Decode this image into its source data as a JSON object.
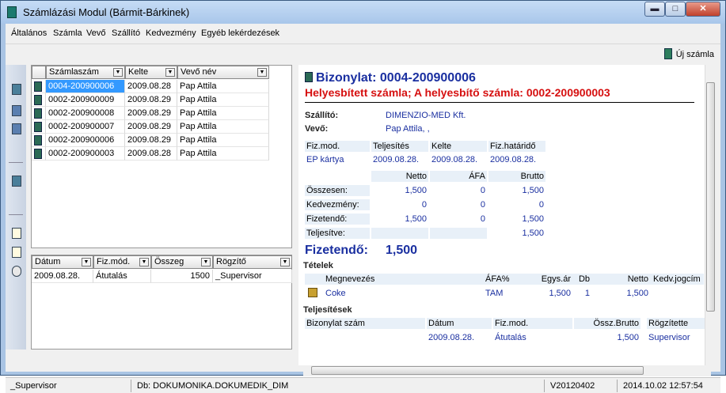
{
  "window": {
    "title": "Számlázási Modul (Bármit-Bárkinek)",
    "min": "▬",
    "max": "□",
    "close": "✕"
  },
  "menu": [
    "Általános",
    "Számla",
    "Vevő",
    "Szállító",
    "Kedvezmény",
    "Egyéb lekérdezések"
  ],
  "toolbar": {
    "new_invoice": "Új számla"
  },
  "invoices": {
    "columns": [
      "Számlaszám",
      "Kelte",
      "Vevő név"
    ],
    "rows": [
      {
        "num": "0004-200900006",
        "date": "2009.08.28",
        "name": "Pap Attila",
        "selected": true
      },
      {
        "num": "0002-200900009",
        "date": "2009.08.29",
        "name": "Pap Attila"
      },
      {
        "num": "0002-200900008",
        "date": "2009.08.29",
        "name": "Pap Attila"
      },
      {
        "num": "0002-200900007",
        "date": "2009.08.29",
        "name": "Pap Attila"
      },
      {
        "num": "0002-200900006",
        "date": "2009.08.29",
        "name": "Pap Attila"
      },
      {
        "num": "0002-200900003",
        "date": "2009.08.28",
        "name": "Pap Attila"
      }
    ]
  },
  "payments": {
    "columns": [
      "Dátum",
      "Fiz.mód.",
      "Összeg",
      "Rögzítő"
    ],
    "rows": [
      {
        "date": "2009.08.28.",
        "mode": "Átutalás",
        "amount": "1500",
        "by": "_Supervisor"
      }
    ]
  },
  "doc": {
    "title": "Bizonylat: 0004-200900006",
    "subtitle": "Helyesbített számla; A helyesbítő számla: 0002-200900003",
    "supplier_label": "Szállító:",
    "supplier": "DIMENZIO-MED Kft.",
    "customer_label": "Vevő:",
    "customer": "Pap Attila,  ,",
    "meta_headers": [
      "Fiz.mod.",
      "Teljesítés",
      "Kelte",
      "Fiz.határidő"
    ],
    "meta_values": [
      "EP kártya",
      "2009.08.28.",
      "2009.08.28.",
      "2009.08.28."
    ],
    "sum_headers": [
      "Netto",
      "ÁFA",
      "Brutto"
    ],
    "sum_rows": [
      {
        "label": "Összesen:",
        "netto": "1,500",
        "afa": "0",
        "brutto": "1,500"
      },
      {
        "label": "Kedvezmény:",
        "netto": "0",
        "afa": "0",
        "brutto": "0"
      },
      {
        "label": "Fizetendő:",
        "netto": "1,500",
        "afa": "0",
        "brutto": "1,500"
      },
      {
        "label": "Teljesítve:",
        "netto": "",
        "afa": "",
        "brutto": "1,500"
      }
    ],
    "payable_label": "Fizetendő:",
    "payable": "1,500",
    "items_title": "Tételek",
    "items_headers": [
      "Megnevezés",
      "ÁFA%",
      "Egys.ár",
      "Db",
      "Netto",
      "Kedv.jogcím"
    ],
    "items": [
      {
        "name": "Coke",
        "vat": "TAM",
        "price": "1,500",
        "qty": "1",
        "net": "1,500",
        "disc": ""
      }
    ],
    "payments_title": "Teljesítések",
    "pay_headers": [
      "Bizonylat szám",
      "Dátum",
      "Fiz.mod.",
      "Össz.Brutto",
      "Rögzítette"
    ],
    "pay_rows": [
      {
        "doc": "",
        "date": "2009.08.28.",
        "mode": "Átutalás",
        "total": "1,500",
        "by": "Supervisor"
      }
    ]
  },
  "status": {
    "user": "_Supervisor",
    "db": "Db: DOKUMONIKA.DOKUMEDIK_DIM",
    "version": "V20120402",
    "datetime": "2014.10.02 12:57:54"
  },
  "colors": {
    "accent": "#1a2fa0",
    "warning": "#d61010",
    "selection": "#3399ff"
  }
}
